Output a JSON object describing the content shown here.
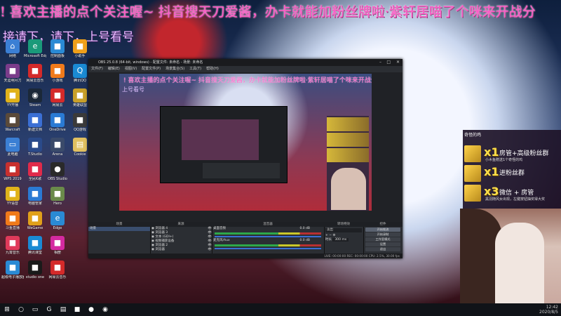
{
  "banner": {
    "line1": "! 喜欢主播的点个关注喔~ 抖音搜天刀爱酱，办卡就能加粉丝牌啦·紫轩居喵了个咪来开战分",
    "line2": "接请下，请下，上号看号"
  },
  "desktop_icons": [
    {
      "label": "网络",
      "icon": "network-icon",
      "color": "#3b7fd4"
    },
    {
      "label": "天涯明月刀",
      "icon": "game-icon",
      "color": "#7a3c8a"
    },
    {
      "label": "YY开播",
      "icon": "yy-icon",
      "color": "#e0b21a"
    },
    {
      "label": "Warcraft",
      "icon": "warcraft-icon",
      "color": "#5a4a3a"
    },
    {
      "label": "此电脑",
      "icon": "computer-icon",
      "color": "#3b7fd4"
    },
    {
      "label": "WPS 2019",
      "icon": "wps-icon",
      "color": "#c8302e"
    },
    {
      "label": "YY语音",
      "icon": "yy-voice-icon",
      "color": "#e0b21a"
    },
    {
      "label": "斗鱼直播",
      "icon": "douyu-icon",
      "color": "#f07a1a"
    },
    {
      "label": "九霄音乐",
      "icon": "music-icon",
      "color": "#e03a5a"
    },
    {
      "label": "超级电子播放器",
      "icon": "player-icon",
      "color": "#2a8ad4"
    },
    {
      "label": "Microsoft Edge",
      "icon": "edge-icon",
      "color": "#1a9a7a"
    },
    {
      "label": "网易云音乐",
      "icon": "netease-icon",
      "color": "#d42a2a"
    },
    {
      "label": "Steam",
      "icon": "steam-icon",
      "color": "#1b2838"
    },
    {
      "label": "新建文档",
      "icon": "doc-icon",
      "color": "#3b6fd4"
    },
    {
      "label": "T.Studio",
      "icon": "tstudio-icon",
      "color": "#2a4a8a"
    },
    {
      "label": "全民K歌",
      "icon": "ksong-icon",
      "color": "#e02a4a"
    },
    {
      "label": "电脑管家",
      "icon": "shield-icon",
      "color": "#2a7ad4"
    },
    {
      "label": "WeGame",
      "icon": "wegame-icon",
      "color": "#e0a01a"
    },
    {
      "label": "腾讯课堂",
      "icon": "classroom-icon",
      "color": "#1a8ad4"
    },
    {
      "label": "studio one",
      "icon": "studio-icon",
      "color": "#1a1a1a"
    },
    {
      "label": "控制面板",
      "icon": "control-panel-icon",
      "color": "#2a8ad4"
    },
    {
      "label": "小游戏",
      "icon": "minigame-icon",
      "color": "#f07a1a"
    },
    {
      "label": "网易云",
      "icon": "cloud-icon",
      "color": "#d42a2a"
    },
    {
      "label": "OneDrive",
      "icon": "onedrive-icon",
      "color": "#2a7ad4"
    },
    {
      "label": "Arena",
      "icon": "arena-icon",
      "color": "#3a4a6a"
    },
    {
      "label": "OBS Studio",
      "icon": "obs-icon",
      "color": "#2a2a2a"
    },
    {
      "label": "Hero",
      "icon": "hero-icon",
      "color": "#6a8a4a"
    },
    {
      "label": "Edge",
      "icon": "ie-icon",
      "color": "#2a8ad4"
    },
    {
      "label": "相册",
      "icon": "photos-icon",
      "color": "#d42aa0"
    },
    {
      "label": "网易云音乐",
      "icon": "netease2-icon",
      "color": "#d42a2a"
    },
    {
      "label": "小助手",
      "icon": "helper-icon",
      "color": "#f0a01a"
    },
    {
      "label": "腾讯QQ",
      "icon": "qq-icon",
      "color": "#1a8ad4"
    },
    {
      "label": "英雄联盟",
      "icon": "lol-icon",
      "color": "#c8a02a"
    },
    {
      "label": "QQ游戏",
      "icon": "qqgame-icon",
      "color": "#3a3a3a"
    },
    {
      "label": "Cookie",
      "icon": "folder-icon",
      "color": "#e0c060"
    }
  ],
  "obs": {
    "title": "OBS 25.0.8 (64-bit, windows) - 配置文件: 未命名 - 场景: 未命名",
    "menu": [
      "文件(F)",
      "编辑(E)",
      "视图(V)",
      "配置文件(P)",
      "场景集合(S)",
      "工具(T)",
      "帮助(H)"
    ],
    "preview_banner": "! 喜欢主播的点个关注喔~ 抖音搜天刀爱酱，办卡就能加粉丝牌啦·紫轩居喵了个咪来开战分",
    "preview_banner2": "上号看号",
    "docks": {
      "scenes": {
        "title": "场景",
        "items": [
          "场景"
        ]
      },
      "sources": {
        "title": "来源",
        "items": [
          "浏览器 4",
          "浏览器 3",
          "文本 (GDI+)",
          "视频捕获设备",
          "浏览器 2",
          "浏览器"
        ]
      },
      "mixer": {
        "title": "混音器",
        "channels": [
          {
            "name": "桌面音频",
            "level": "0.0 dB"
          },
          {
            "name": "麦克风/Aux",
            "level": "0.0 dB"
          }
        ]
      },
      "transitions": {
        "title": "转场特效",
        "type": "淡出",
        "duration_label": "时长",
        "duration": "300 ms"
      },
      "controls": {
        "title": "控件",
        "buttons": [
          "开始推流",
          "开始录制",
          "工作室模式",
          "设置",
          "退出"
        ],
        "active": 0
      }
    },
    "status": "LIVE: 00:00:00  REC: 00:00:00  CPU: 2.5%, 30.00 fps"
  },
  "gift_panel": {
    "title": "奇怪的鸡",
    "rows": [
      {
        "mult": "x1",
        "text": "房管+高级粉丝群",
        "sub": "小木鱼赠送1个奇怪的鸡"
      },
      {
        "mult": "x1",
        "text": "进粉丝群",
        "sub": ""
      },
      {
        "mult": "x3",
        "text": "微信 + 房管",
        "sub": "黑羽随风女出现，左键按钮抽奖得大奖"
      }
    ]
  },
  "taskbar": {
    "items": [
      "start-icon",
      "search-icon",
      "taskview-icon",
      "game-icon",
      "explorer-icon",
      "app-icon",
      "netease-icon",
      "obs-icon"
    ],
    "time": "12:42",
    "date": "2020/8/5"
  }
}
